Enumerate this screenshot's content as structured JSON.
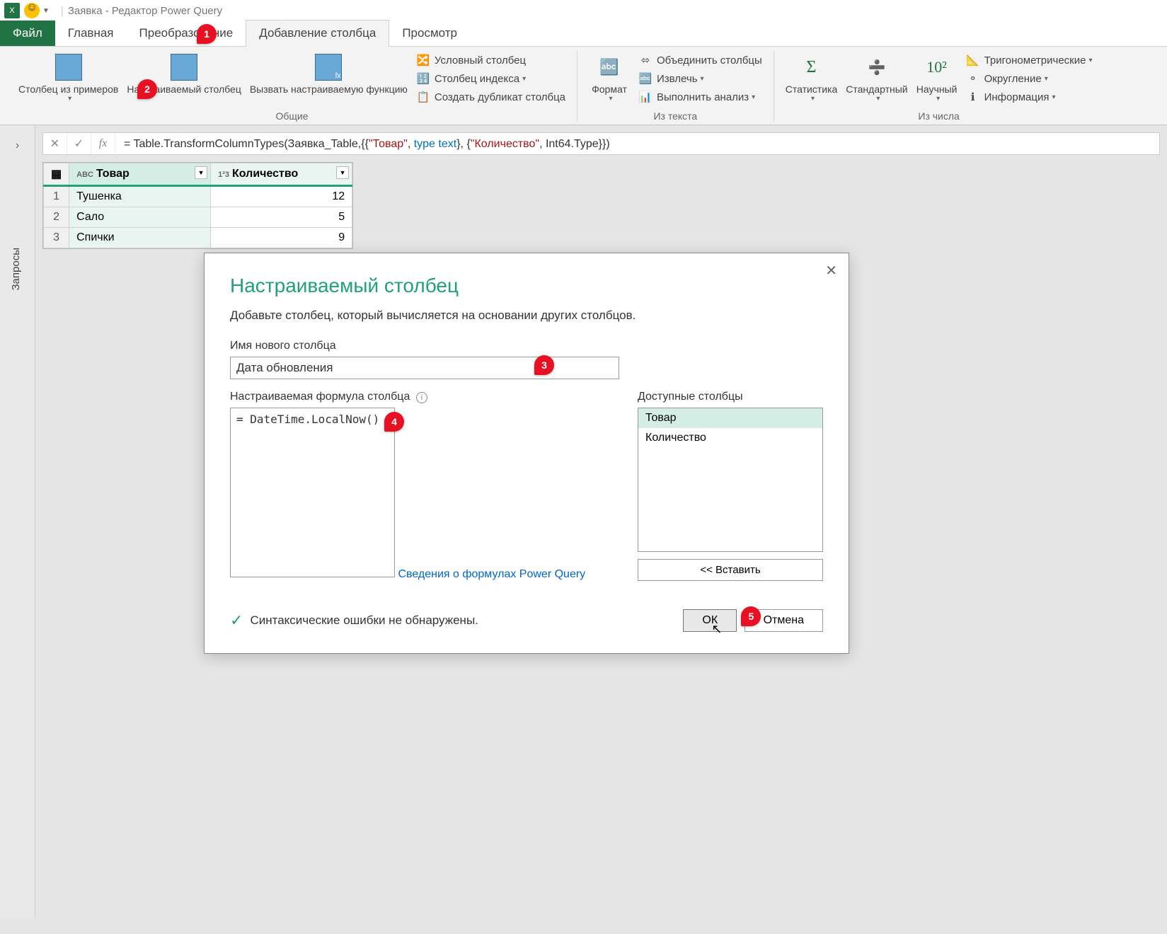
{
  "titlebar": {
    "title": "Заявка - Редактор Power Query"
  },
  "tabs": {
    "file": "Файл",
    "home": "Главная",
    "transform": "Преобразование",
    "addcolumn": "Добавление столбца",
    "view": "Просмотр"
  },
  "ribbon": {
    "col_from_examples": "Столбец из примеров",
    "custom_column": "Настраиваемый столбец",
    "invoke_custom_fn": "Вызвать настраиваемую функцию",
    "group_general": "Общие",
    "conditional_col": "Условный столбец",
    "index_col": "Столбец индекса",
    "duplicate_col": "Создать дубликат столбца",
    "format": "Формат",
    "merge_cols": "Объединить столбцы",
    "extract": "Извлечь",
    "analyze": "Выполнить анализ",
    "group_text": "Из текста",
    "statistics": "Статистика",
    "standard": "Стандартный",
    "scientific": "Научный",
    "trig": "Тригонометрические",
    "rounding": "Округление",
    "information": "Информация",
    "group_number": "Из числа"
  },
  "queries_label": "Запросы",
  "formula": {
    "prefix": "= Table.TransformColumnTypes(Заявка_Table,{{",
    "s1": "\"Товар\"",
    "mid1": ", ",
    "kw1": "type",
    "sp": " ",
    "kw2": "text",
    "mid2": "}, {",
    "s2": "\"Количество\"",
    "mid3": ", Int64.Type}})"
  },
  "grid": {
    "col1": "Товар",
    "col2": "Количество",
    "rows": [
      {
        "n": "1",
        "c1": "Тушенка",
        "c2": "12"
      },
      {
        "n": "2",
        "c1": "Сало",
        "c2": "5"
      },
      {
        "n": "3",
        "c1": "Спички",
        "c2": "9"
      }
    ]
  },
  "dialog": {
    "title": "Настраиваемый столбец",
    "subtitle": "Добавьте столбец, который вычисляется на основании других столбцов.",
    "name_label": "Имя нового столбца",
    "name_value": "Дата обновления",
    "formula_label": "Настраиваемая формула столбца",
    "formula_value": "= DateTime.LocalNow()",
    "avail_label": "Доступные столбцы",
    "avail_items": [
      "Товар",
      "Количество"
    ],
    "insert_btn": "<< Вставить",
    "link": "Сведения о формулах Power Query",
    "status": "Синтаксические ошибки не обнаружены.",
    "ok": "ОК",
    "cancel": "Отмена"
  },
  "callouts": {
    "c1": "1",
    "c2": "2",
    "c3": "3",
    "c4": "4",
    "c5": "5"
  }
}
